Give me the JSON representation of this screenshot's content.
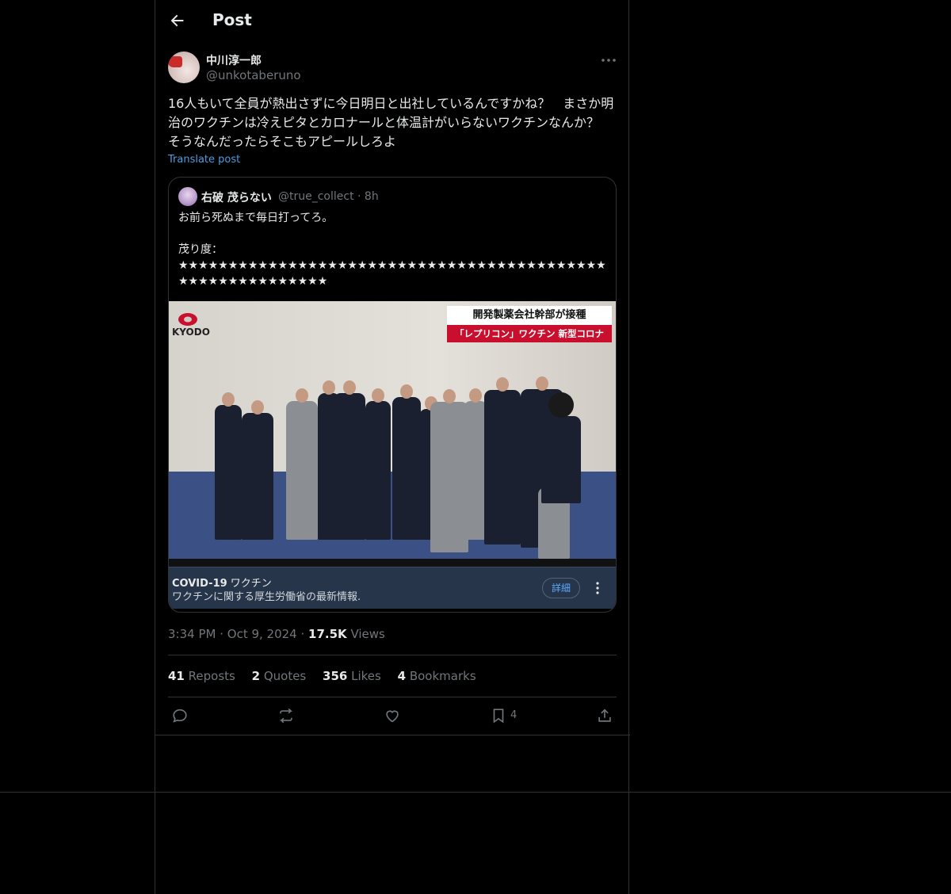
{
  "header": {
    "title": "Post",
    "back_icon": "arrow-left-icon"
  },
  "author": {
    "name": "中川淳一郎",
    "handle": "@unkotaberuno"
  },
  "post": {
    "text": "16人もいて全員が熱出さずに今日明日と出社しているんですかね？　まさか明治のワクチンは冷えピタとカロナールと体温計がいらないワクチンなんか？　そうなんだったらそこもアピールしろよ",
    "translate_label": "Translate post"
  },
  "quote": {
    "name": "右破 茂らない",
    "handle_time": "@true_collect · 8h",
    "text": "お前ら死ぬまで毎日打ってろ。\n\n茂り度：\n★★★★★★★★★★★★★★★★★★★★★★★★★★★★★★★★★★★★★★★★★★★★★★★★★★★★★★★★★★",
    "media": {
      "logo_text": "KYODO",
      "banner_line1": "開発製薬会社幹部が接種",
      "banner_line2": "「レプリコン」ワクチン 新型コロナ"
    },
    "notice": {
      "title_bold": "COVID-19",
      "title_rest": " ワクチン",
      "subtitle": "ワクチンに関する厚生労働省の最新情報.",
      "button_label": "詳細"
    }
  },
  "meta": {
    "time": "3:34 PM",
    "date": "Oct 9, 2024",
    "views": "17.5K",
    "views_label": " Views",
    "sep": " · "
  },
  "stats": {
    "reposts": "41",
    "reposts_label": " Reposts",
    "quotes": "2",
    "quotes_label": " Quotes",
    "likes": "356",
    "likes_label": " Likes",
    "bookmarks": "4",
    "bookmarks_label": " Bookmarks"
  },
  "actions": {
    "bookmark_count": "4"
  },
  "colors": {
    "background": "#000000",
    "border": "#2f3336",
    "link": "#4a9ee0",
    "muted": "#71767b"
  }
}
